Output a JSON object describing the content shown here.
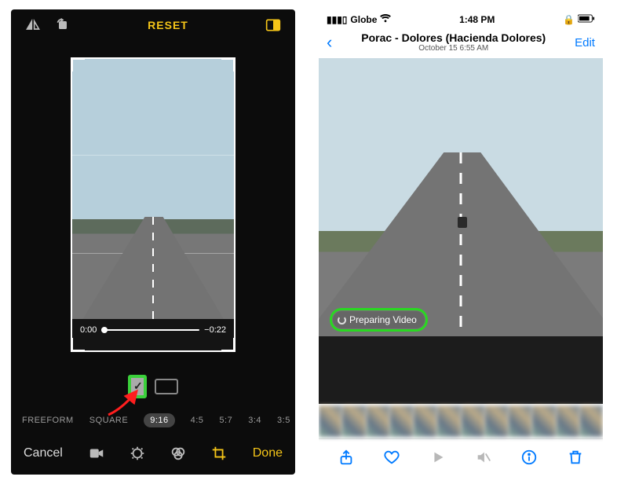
{
  "left": {
    "top": {
      "reset": "RESET"
    },
    "scrub": {
      "current": "0:00",
      "remaining": "−0:22"
    },
    "ratios": [
      "FREEFORM",
      "SQUARE",
      "9:16",
      "4:5",
      "5:7",
      "3:4",
      "3:5"
    ],
    "selected_ratio": "9:16",
    "bottom": {
      "cancel": "Cancel",
      "done": "Done"
    },
    "orientations": {
      "portrait_checked": true
    }
  },
  "right": {
    "status": {
      "carrier": "Globe",
      "time": "1:48 PM"
    },
    "nav": {
      "title": "Porac - Dolores (Hacienda Dolores)",
      "subtitle": "October 15  6:55 AM",
      "edit": "Edit"
    },
    "overlay": {
      "preparing": "Preparing Video"
    }
  },
  "colors": {
    "accent_yellow": "#f5c518",
    "ios_blue": "#007aff",
    "highlight_green": "#29d821"
  }
}
